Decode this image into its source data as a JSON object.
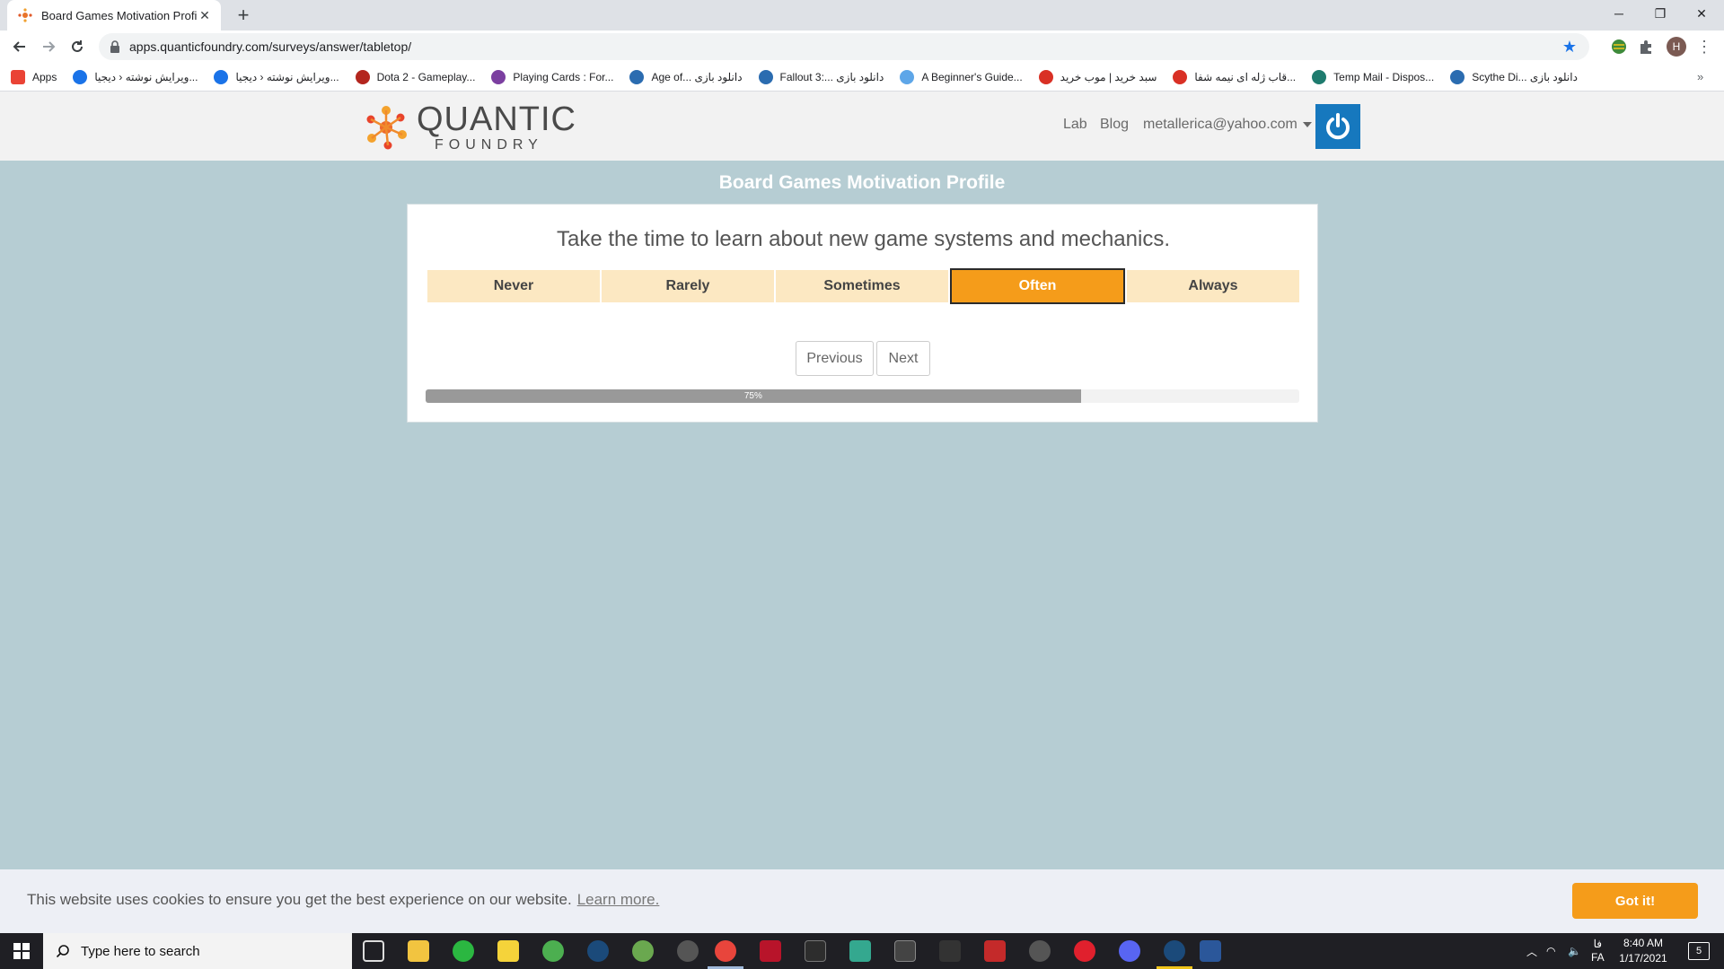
{
  "browser": {
    "tab_title": "Board Games Motivation Profile",
    "url": "apps.quanticfoundry.com/surveys/answer/tabletop/",
    "profile_initial": "H"
  },
  "bookmarks": [
    {
      "label": "Apps",
      "color": "#ea4335"
    },
    {
      "label": "ویرایش نوشته ‹ دیجیا...",
      "color": "#1a73e8"
    },
    {
      "label": "ویرایش نوشته ‹ دیجیا...",
      "color": "#1a73e8"
    },
    {
      "label": "Dota 2 - Gameplay...",
      "color": "#b3261e"
    },
    {
      "label": "Playing Cards : For...",
      "color": "#7b3fa0"
    },
    {
      "label": "Age of... دانلود بازی",
      "color": "#2b6cb0"
    },
    {
      "label": "Fallout 3:... دانلود بازی",
      "color": "#2b6cb0"
    },
    {
      "label": "A Beginner's Guide...",
      "color": "#5ea6e8"
    },
    {
      "label": "سبد خرید | موب خرید",
      "color": "#d93025"
    },
    {
      "label": "قاب ژله ای نیمه شفا...",
      "color": "#d93025"
    },
    {
      "label": "Temp Mail - Dispos...",
      "color": "#1e7b6e"
    },
    {
      "label": "Scythe Di... دانلود بازی",
      "color": "#2b6cb0"
    }
  ],
  "site": {
    "logo_top": "QUANTIC",
    "logo_bottom": "FOUNDRY",
    "nav_lab": "Lab",
    "nav_blog": "Blog",
    "nav_user": "metallerica@yahoo.com"
  },
  "survey": {
    "title": "Board Games Motivation Profile",
    "question": "Take the time to learn about new game systems and mechanics.",
    "answers": [
      "Never",
      "Rarely",
      "Sometimes",
      "Often",
      "Always"
    ],
    "selected_answer": "Often",
    "previous_label": "Previous",
    "next_label": "Next",
    "progress_percent": 75,
    "progress_label": "75%"
  },
  "cookie": {
    "message": "This website uses cookies to ensure you get the best experience on our website.",
    "link": "Learn more.",
    "button": "Got it!"
  },
  "taskbar": {
    "search_placeholder": "Type here to search",
    "lang_top": "فا",
    "lang_bottom": "FA",
    "time": "8:40 AM",
    "date": "1/17/2021",
    "notifications": "5"
  },
  "colors": {
    "accent": "#f59c1a",
    "answer_bg": "#fce8c2",
    "page_bg": "#b6cdd3",
    "power_button": "#1678be"
  }
}
